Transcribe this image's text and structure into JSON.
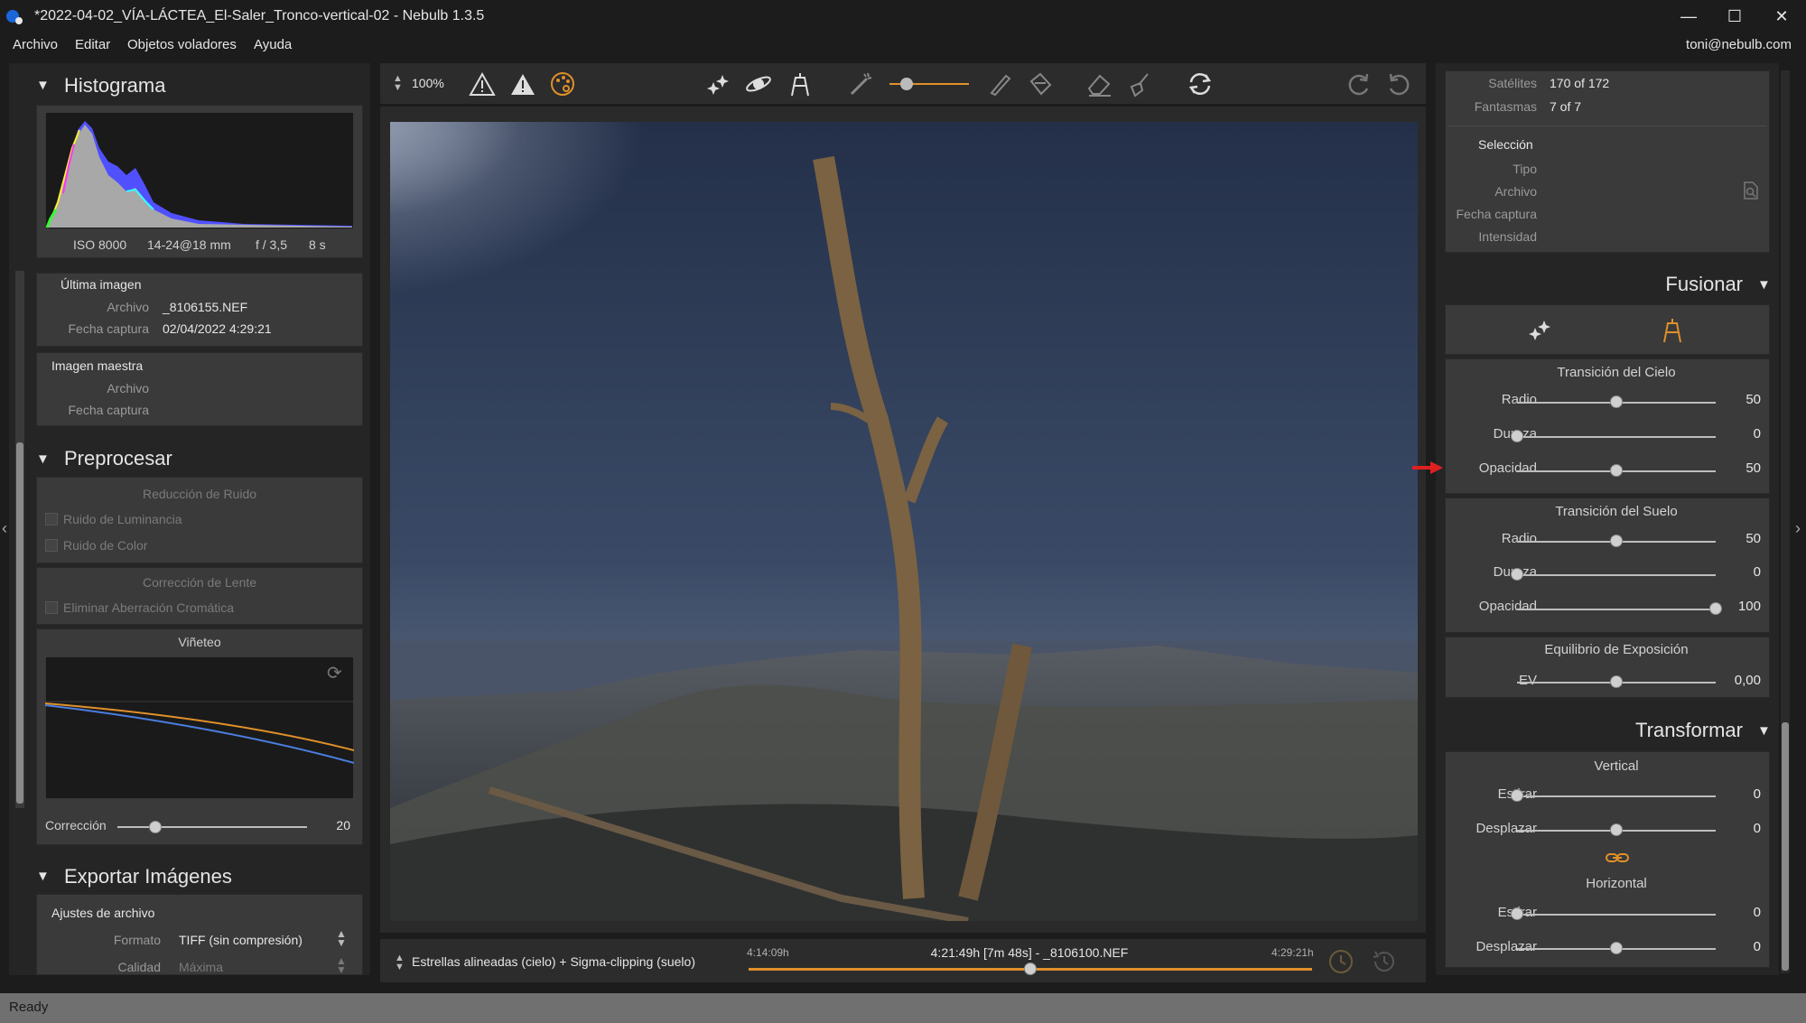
{
  "window": {
    "title": "*2022-04-02_VÍA-LÁCTEA_El-Saler_Tronco-vertical-02 - Nebulb 1.3.5",
    "minimize": "—",
    "maximize": "☐",
    "close": "✕"
  },
  "menu": {
    "items": [
      "Archivo",
      "Editar",
      "Objetos voladores",
      "Ayuda"
    ],
    "user_email": "toni@nebulb.com"
  },
  "histogram": {
    "title": "Histograma",
    "iso": "ISO 8000",
    "lens": "14-24@18 mm",
    "aperture": "f / 3,5",
    "exposure": "8 s"
  },
  "last_image": {
    "title": "Última imagen",
    "file_label": "Archivo",
    "file_value": "_8106155.NEF",
    "date_label": "Fecha captura",
    "date_value": "02/04/2022 4:29:21"
  },
  "master_image": {
    "title": "Imagen maestra",
    "file_label": "Archivo",
    "date_label": "Fecha captura"
  },
  "preprocess": {
    "title": "Preprocesar",
    "noise_title": "Reducción de Ruido",
    "luminance_noise": "Ruido de Luminancia",
    "color_noise": "Ruido de Color",
    "lens_title": "Corrección de Lente",
    "chromatic": "Eliminar Aberración Cromática",
    "vignette_title": "Viñeteo",
    "correction_label": "Corrección",
    "correction_value": "20",
    "correction_level": 0.2
  },
  "export": {
    "title": "Exportar Imágenes",
    "file_settings": "Ajustes de archivo",
    "format_label": "Formato",
    "format_value": "TIFF (sin compresión)",
    "quality_label": "Calidad",
    "quality_value": "Máxima"
  },
  "toolbar": {
    "zoom": "100%"
  },
  "timeline": {
    "mode": "Estrellas alineadas (cielo) + Sigma-clipping (suelo)",
    "start_time": "4:14:09h",
    "current": "4:21:49h [7m 48s] - _8106100.NEF",
    "end_time": "4:29:21h",
    "position": 0.5
  },
  "stats": {
    "satellites_label": "Satélites",
    "satellites_value": "170 of 172",
    "ghosts_label": "Fantasmas",
    "ghosts_value": "7 of 7",
    "selection_title": "Selección",
    "type_label": "Tipo",
    "file_label": "Archivo",
    "date_label": "Fecha captura",
    "intensity_label": "Intensidad"
  },
  "blend": {
    "title": "Fusionar",
    "sky_title": "Transición del Cielo",
    "sky_radius_label": "Radio",
    "sky_radius_value": "50",
    "sky_radius_level": 0.5,
    "sky_hardness_label": "Dureza",
    "sky_hardness_value": "0",
    "sky_hardness_level": 0.0,
    "sky_opacity_label": "Opacidad",
    "sky_opacity_value": "50",
    "sky_opacity_level": 0.5,
    "ground_title": "Transición del Suelo",
    "ground_radius_label": "Radio",
    "ground_radius_value": "50",
    "ground_radius_level": 0.5,
    "ground_hardness_label": "Dureza",
    "ground_hardness_value": "0",
    "ground_hardness_level": 0.0,
    "ground_opacity_label": "Opacidad",
    "ground_opacity_value": "100",
    "ground_opacity_level": 1.0,
    "exposure_title": "Equilibrio de Exposición",
    "ev_label": "EV",
    "ev_value": "0,00",
    "ev_level": 0.5
  },
  "transform": {
    "title": "Transformar",
    "vertical_title": "Vertical",
    "v_stretch_label": "Estirar",
    "v_stretch_value": "0",
    "v_stretch_level": 0.0,
    "v_shift_label": "Desplazar",
    "v_shift_value": "0",
    "v_shift_level": 0.5,
    "horizontal_title": "Horizontal",
    "h_stretch_label": "Estirar",
    "h_stretch_value": "0",
    "h_stretch_level": 0.0,
    "h_shift_label": "Desplazar",
    "h_shift_value": "0",
    "h_shift_level": 0.5
  },
  "status": {
    "text": "Ready"
  },
  "colors": {
    "accent": "#e0902a",
    "arrow": "#e02020"
  }
}
